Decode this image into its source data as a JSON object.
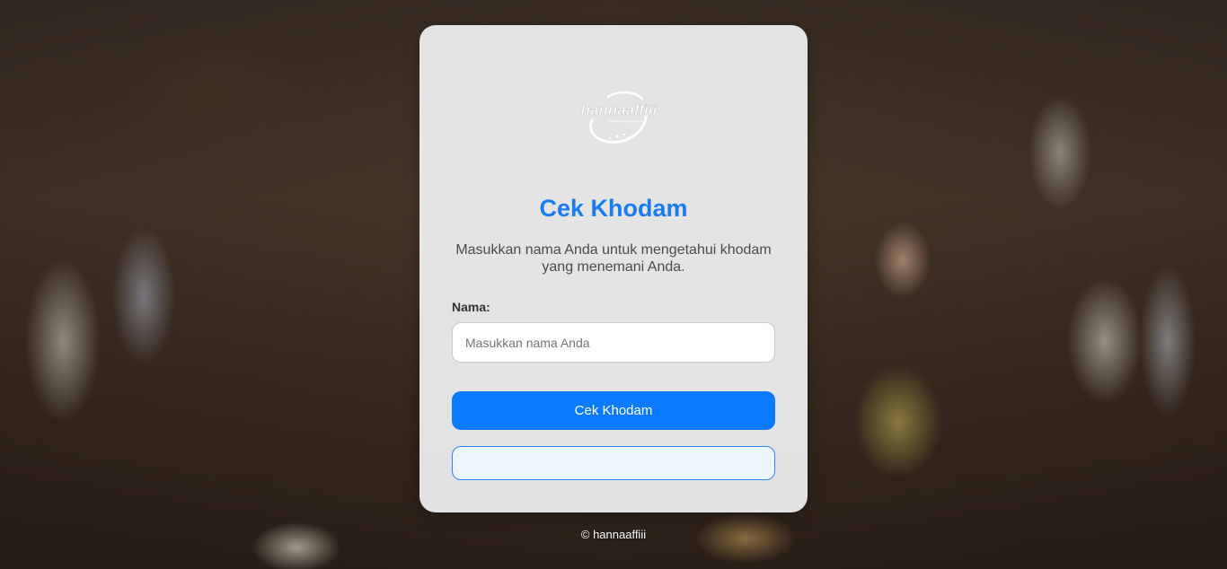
{
  "logo": {
    "text": "hannaaffiii",
    "tagline": "Nothing is Impossible",
    "icon": "logo-icon"
  },
  "card": {
    "title": "Cek Khodam",
    "subtitle": "Masukkan nama Anda untuk mengetahui khodam yang menemani Anda.",
    "name_label": "Nama:",
    "name_placeholder": "Masukkan nama Anda",
    "name_value": "",
    "submit_label": "Cek Khodam",
    "result_text": ""
  },
  "footer": {
    "text": "© hannaaffiii"
  },
  "colors": {
    "accent": "#0a7bff",
    "title": "#1a7cf0",
    "result_border": "#2f86e8",
    "result_bg": "#eef6fd"
  }
}
